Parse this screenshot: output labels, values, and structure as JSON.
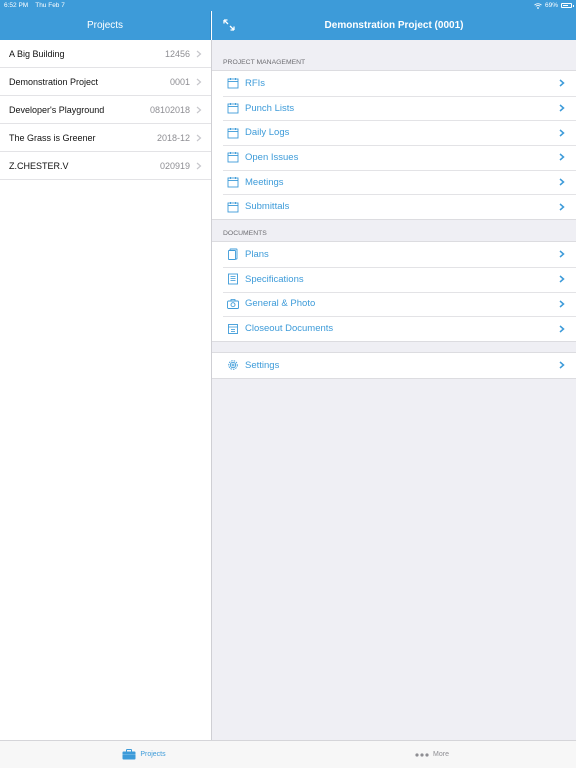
{
  "status_bar": {
    "time": "6:52 PM",
    "date": "Thu Feb 7",
    "battery": "69%"
  },
  "left_header": {
    "title": "Projects"
  },
  "right_header": {
    "title": "Demonstration Project (0001)"
  },
  "projects": [
    {
      "name": "A Big Building",
      "code": "12456"
    },
    {
      "name": "Demonstration Project",
      "code": "0001"
    },
    {
      "name": "Developer's Playground",
      "code": "08102018"
    },
    {
      "name": "The Grass is Greener",
      "code": "2018-12"
    },
    {
      "name": "Z.CHESTER.V",
      "code": "020919"
    }
  ],
  "sections": {
    "project_management": {
      "header": "PROJECT MANAGEMENT",
      "items": [
        {
          "label": "RFIs",
          "icon": "calendar-icon"
        },
        {
          "label": "Punch Lists",
          "icon": "calendar-icon"
        },
        {
          "label": "Daily Logs",
          "icon": "calendar-icon"
        },
        {
          "label": "Open Issues",
          "icon": "calendar-icon"
        },
        {
          "label": "Meetings",
          "icon": "calendar-icon"
        },
        {
          "label": "Submittals",
          "icon": "calendar-icon"
        }
      ]
    },
    "documents": {
      "header": "DOCUMENTS",
      "items": [
        {
          "label": "Plans",
          "icon": "plans-icon"
        },
        {
          "label": "Specifications",
          "icon": "specifications-icon"
        },
        {
          "label": "General & Photo",
          "icon": "camera-icon"
        },
        {
          "label": "Closeout Documents",
          "icon": "closeout-icon"
        }
      ]
    },
    "settings": {
      "label": "Settings",
      "icon": "gear-icon"
    }
  },
  "tab_bar": {
    "projects_label": "Projects",
    "more_label": "More"
  },
  "colors": {
    "accent": "#3d9bd9",
    "background": "#efeff4",
    "secondary_text": "#8e8e93"
  }
}
